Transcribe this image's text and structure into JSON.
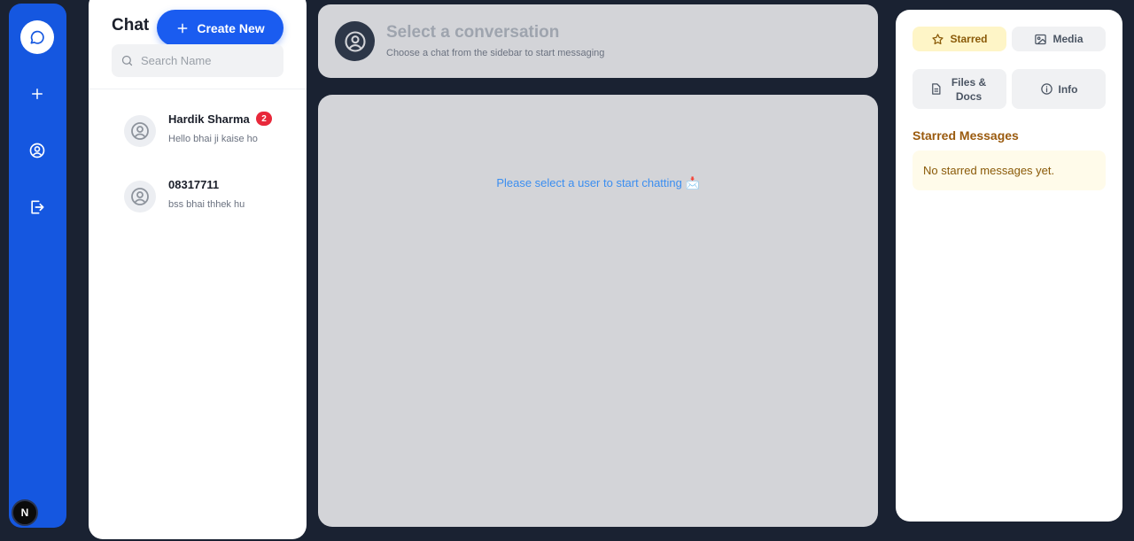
{
  "rail": {
    "items": [
      {
        "name": "chat",
        "icon": "chat-bubble-icon",
        "active": true
      },
      {
        "name": "new",
        "icon": "plus-icon",
        "active": false
      },
      {
        "name": "profile",
        "icon": "user-circle-icon",
        "active": false
      },
      {
        "name": "logout",
        "icon": "logout-icon",
        "active": false
      }
    ],
    "avatar_letter": "N"
  },
  "sidebar": {
    "title": "Chat",
    "create_label": "Create New",
    "search_placeholder": "Search Name",
    "contacts": [
      {
        "name": "Hardik Sharma",
        "last_message": "Hello bhai ji kaise ho",
        "unread": "2"
      },
      {
        "name": "08317711",
        "last_message": "bss bhai thhek hu",
        "unread": ""
      }
    ]
  },
  "conversation": {
    "title": "Select a conversation",
    "subtitle": "Choose a chat from the sidebar to start messaging",
    "empty_text": "Please select a user to start chatting 📩"
  },
  "info_panel": {
    "tabs": [
      {
        "label": "Starred",
        "icon": "star-icon",
        "active": true
      },
      {
        "label": "Media",
        "icon": "image-icon",
        "active": false
      },
      {
        "label": "Files & Docs",
        "icon": "document-icon",
        "active": false
      },
      {
        "label": "Info",
        "icon": "info-icon",
        "active": false
      }
    ],
    "starred_title": "Starred Messages",
    "starred_empty": "No starred messages yet."
  },
  "colors": {
    "background": "#1a2232",
    "rail": "#1557e0",
    "accent": "#1a5cf0",
    "badge": "#e8283a",
    "starred_text": "#9a5a0e",
    "starred_bg": "#fef5c7",
    "empty_link": "#3b8ef0"
  }
}
